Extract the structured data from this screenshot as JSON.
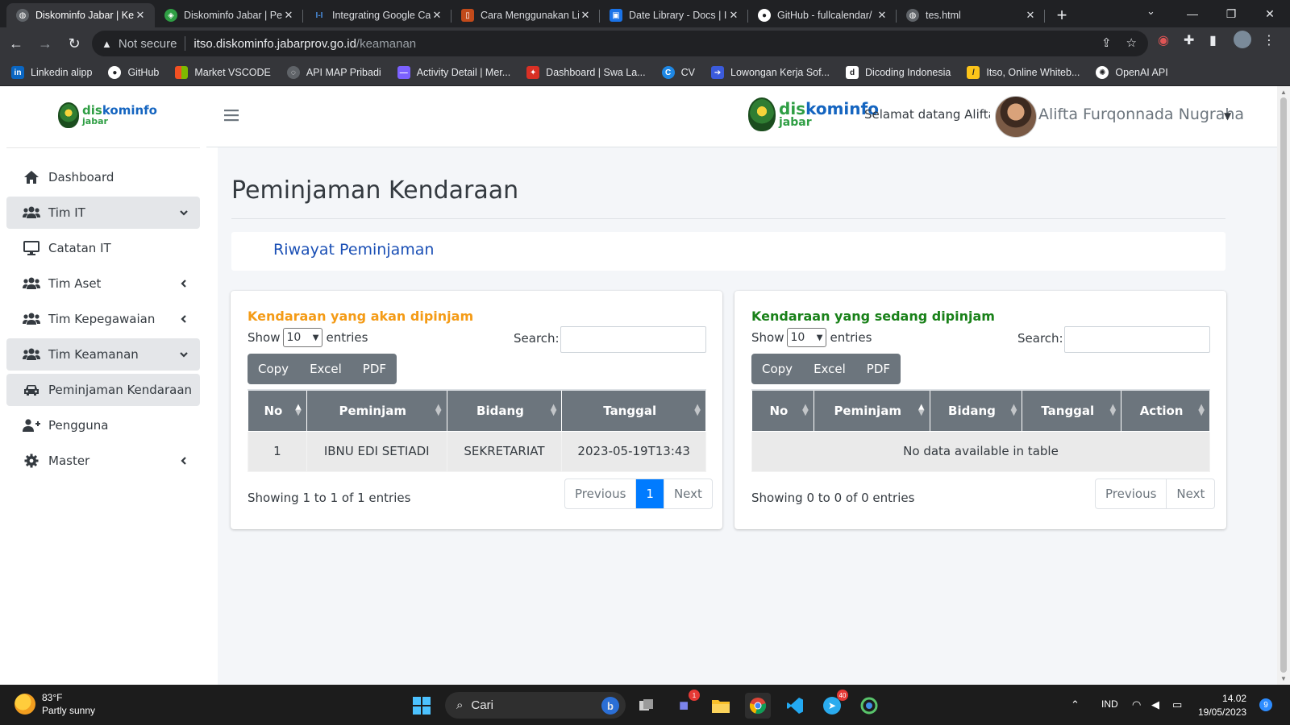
{
  "browser": {
    "tabs": [
      {
        "title": "Diskominfo Jabar | Ke",
        "icon": "globe-icon",
        "color": "#9aa0a6",
        "active": true
      },
      {
        "title": "Diskominfo Jabar | Pe",
        "icon": "jabar-icon",
        "color": "#2f9e44",
        "active": false
      },
      {
        "title": "Integrating Google Ca",
        "icon": "ih-icon",
        "color": "#4a8fe0",
        "active": false
      },
      {
        "title": "Cara Menggunakan Li",
        "icon": "book-icon",
        "color": "#c24a1a",
        "active": false
      },
      {
        "title": "Date Library - Docs | I",
        "icon": "docs-icon",
        "color": "#1a73e8",
        "active": false
      },
      {
        "title": "GitHub - fullcalendar/",
        "icon": "github-icon",
        "color": "#ffffff",
        "active": false
      },
      {
        "title": "tes.html",
        "icon": "globe-icon",
        "color": "#9aa0a6",
        "active": false
      }
    ],
    "security_label": "Not secure",
    "url_host": "itso.diskominfo.jabarprov.go.id",
    "url_path": "/keamanan",
    "bookmarks": [
      {
        "label": "Linkedin alipp",
        "icon": "linkedin-icon",
        "color": "#0a66c2"
      },
      {
        "label": "GitHub",
        "icon": "github-icon",
        "color": "#35363a"
      },
      {
        "label": "Market VSCODE",
        "icon": "windows-icon",
        "color": "#f25022"
      },
      {
        "label": "API MAP Pribadi",
        "icon": "api-icon",
        "color": "#5f6368"
      },
      {
        "label": "Activity Detail | Mer...",
        "icon": "activity-icon",
        "color": "#7b61ff"
      },
      {
        "label": "Dashboard | Swa La...",
        "icon": "dashboard-icon",
        "color": "#d93025"
      },
      {
        "label": "CV",
        "icon": "cv-icon",
        "color": "#1e88e5"
      },
      {
        "label": "Lowongan Kerja Sof...",
        "icon": "job-icon",
        "color": "#3b5bdb"
      },
      {
        "label": "Dicoding Indonesia",
        "icon": "dicoding-icon",
        "color": "#35363a"
      },
      {
        "label": "Itso, Online Whiteb...",
        "icon": "whiteboard-icon",
        "color": "#fcc419"
      },
      {
        "label": "OpenAI API",
        "icon": "openai-icon",
        "color": "#35363a"
      }
    ]
  },
  "app": {
    "logo_text_1": "diskominfo",
    "logo_text_2": "jabar",
    "welcome": "Selamat datang Alifta F",
    "user_name": "Alifta Furqonnada Nugraha",
    "sidebar": [
      {
        "label": "Dashboard",
        "icon": "home-icon",
        "chevron": ""
      },
      {
        "label": "Tim IT",
        "icon": "users-icon",
        "chevron": "down"
      },
      {
        "label": "Catatan IT",
        "icon": "desktop-icon",
        "chevron": ""
      },
      {
        "label": "Tim Aset",
        "icon": "users-icon",
        "chevron": "left"
      },
      {
        "label": "Tim Kepegawaian",
        "icon": "users-icon",
        "chevron": "left"
      },
      {
        "label": "Tim Keamanan",
        "icon": "users-icon",
        "chevron": "down"
      },
      {
        "label": "Peminjaman Kendaraan",
        "icon": "car-icon",
        "chevron": ""
      },
      {
        "label": "Pengguna",
        "icon": "user-plus-icon",
        "chevron": ""
      },
      {
        "label": "Master",
        "icon": "gear-icon",
        "chevron": "left"
      }
    ],
    "page_title": "Peminjaman Kendaraan",
    "tab_label": "Riwayat Peminjaman",
    "cards": [
      {
        "title": "Kendaraan yang akan dipinjam",
        "title_color": "#f49b16",
        "show_label": "Show",
        "entries_value": "10",
        "entries_label": "entries",
        "search_label": "Search:",
        "buttons": [
          "Copy",
          "Excel",
          "PDF"
        ],
        "columns": [
          "No",
          "Peminjam",
          "Bidang",
          "Tanggal"
        ],
        "rows": [
          [
            "1",
            "IBNU EDI SETIADI",
            "SEKRETARIAT",
            "2023-05-19T13:43"
          ]
        ],
        "info": "Showing 1 to 1 of 1 entries",
        "pagination": [
          "Previous",
          "1",
          "Next"
        ]
      },
      {
        "title": "Kendaraan yang sedang dipinjam",
        "title_color": "#198119",
        "show_label": "Show",
        "entries_value": "10",
        "entries_label": "entries",
        "search_label": "Search:",
        "buttons": [
          "Copy",
          "Excel",
          "PDF"
        ],
        "columns": [
          "No",
          "Peminjam",
          "Bidang",
          "Tanggal",
          "Action"
        ],
        "empty_text": "No data available in table",
        "info": "Showing 0 to 0 of 0 entries",
        "pagination": [
          "Previous",
          "Next"
        ]
      }
    ]
  },
  "taskbar": {
    "temperature": "83°F",
    "weather": "Partly sunny",
    "search_placeholder": "Cari",
    "teams_badge": "1",
    "telegram_badge": "40",
    "language": "IND",
    "time": "14.02",
    "date": "19/05/2023",
    "notification_count": "9"
  }
}
